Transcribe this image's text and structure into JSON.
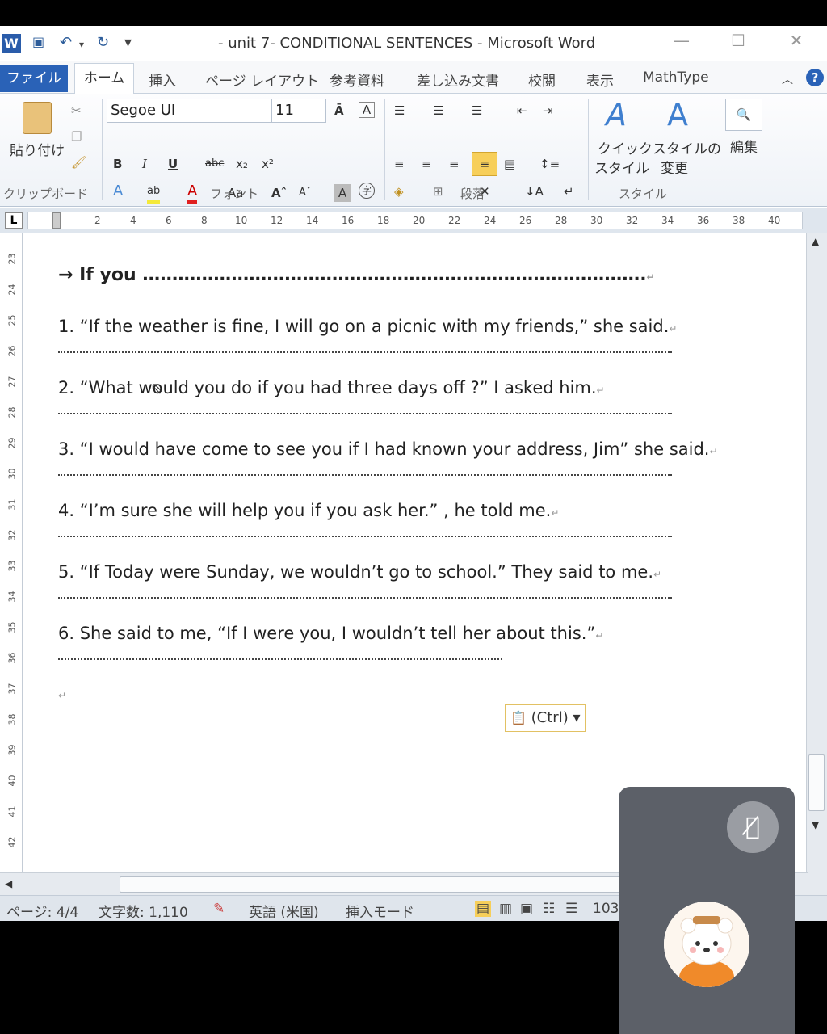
{
  "window": {
    "title": "- unit 7- CONDITIONAL SENTENCES - Microsoft Word",
    "minimize": "—",
    "maximize": "☐",
    "close": "✕"
  },
  "qat": {
    "word": "W",
    "save": "💾",
    "undo": "↶",
    "redo": "↻",
    "more": "▾"
  },
  "tabs": {
    "file": "ファイル",
    "home": "ホーム",
    "items": [
      "挿入",
      "ページ レイアウト",
      "参考資料",
      "差し込み文書",
      "校閲",
      "表示",
      "MathType"
    ]
  },
  "ribbon": {
    "paste_label": "貼り付け",
    "clipboard_group": "クリップボード",
    "font_name": "Segoe UI",
    "font_size": "11",
    "font_group": "フォント",
    "paragraph_group": "段落",
    "quick_style": "クイック\nスタイル",
    "quick_style_1": "クイック",
    "quick_style_2": "スタイル",
    "change_style_1": "スタイルの",
    "change_style_2": "変更",
    "style_group": "スタイル",
    "edit_label": "編集"
  },
  "ruler": {
    "h_ticks": [
      "2",
      "4",
      "6",
      "8",
      "10",
      "12",
      "14",
      "16",
      "18",
      "20",
      "22",
      "24",
      "26",
      "28",
      "30",
      "32",
      "34",
      "36",
      "38",
      "40"
    ],
    "v_ticks": [
      "23",
      "24",
      "25",
      "26",
      "27",
      "28",
      "29",
      "30",
      "31",
      "32",
      "33",
      "34",
      "35",
      "36",
      "37",
      "38",
      "39",
      "40",
      "41",
      "42"
    ],
    "corner": "L"
  },
  "document": {
    "heading": "→ If you ………………………………………………………………………….",
    "questions": [
      "1. “If the weather is fine, I will go on a picnic with my friends,” she said.",
      "2. “What would you do if you had three days off ?” I asked him.",
      "3. “I would have come to see you if I had known your address, Jim” she said.",
      "4. “I’m sure she will help you if you ask her.” , he told me.",
      "5. “If Today were Sunday, we wouldn’t go to school.” They said to me.",
      "6. She said to me, “If I were you, I wouldn’t tell her about this.”"
    ],
    "para_mark": "↵",
    "paste_options": "(Ctrl)"
  },
  "status": {
    "page": "ページ: 4/4",
    "words": "文字数: 1,110",
    "language": "英語 (米国)",
    "mode": "挿入モード",
    "zoom": "103"
  },
  "colors": {
    "file_tab": "#2a62b7",
    "accent": "#2c5c9a"
  }
}
